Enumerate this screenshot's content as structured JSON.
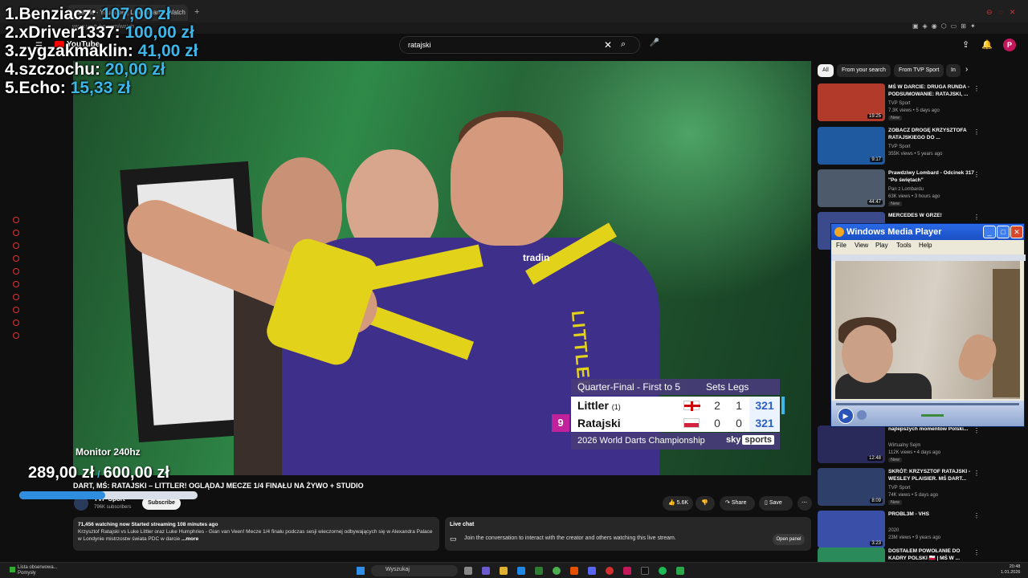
{
  "browser": {
    "tab_title": "ratajski - YouTube | Livestream - Watch",
    "url": "www.youtube.com/watch"
  },
  "youtube": {
    "logo": "YouTube",
    "search_value": "ratajski",
    "avatar_letter": "P"
  },
  "leaderboard": [
    {
      "rank": "1.",
      "name": "Benziacz:",
      "amount": "107,00 zł"
    },
    {
      "rank": "2.",
      "name": "xDriver1337:",
      "amount": "100,00 zł"
    },
    {
      "rank": "3.",
      "name": "zygzakmaklin:",
      "amount": "41,00 zł"
    },
    {
      "rank": "4.",
      "name": "szczochu:",
      "amount": "20,00 zł"
    },
    {
      "rank": "5.",
      "name": "Echo:",
      "amount": "15,33 zł"
    }
  ],
  "donation_goal": {
    "label": "Monitor 240hz",
    "current": "289,00 zł",
    "target": "600,00 zł",
    "progress": 0.48
  },
  "scoreboard": {
    "header_left": "Quarter-Final - First to 5",
    "header_right": "Sets Legs",
    "throwing_score": "9",
    "players": [
      {
        "name": "Littler",
        "seed": "(1)",
        "flag": "england",
        "sets": "2",
        "legs": "1",
        "points": "321"
      },
      {
        "name": "Ratajski",
        "seed": "",
        "flag": "poland",
        "sets": "0",
        "legs": "0",
        "points": "321"
      }
    ],
    "footer": "2026 World Darts Championship",
    "broadcaster": "sky",
    "broadcaster_tag": "sports"
  },
  "video": {
    "shirt_name": "LITTLER",
    "shirt_logo": "tradin",
    "title": "DART, MŚ: RATAJSKI – LITTLER! OGLĄDAJ MECZE 1/4 FINAŁU NA ŻYWO + STUDIO",
    "channel": "TVP Sport",
    "subscribers": "796K subscribers",
    "subscribe_label": "Subscribe",
    "likes": "5.6K",
    "share_label": "Share",
    "save_label": "Save"
  },
  "description": {
    "stats": "71,456 watching now  Started streaming 108 minutes ago",
    "text": "Krzysztof Ratajski vs Luke Littler oraz Luke Humphries - Gian van Veen! Mecze 1/4 finału podczas sesji wieczornej odbywających się w Alexandra Palace w Londynie mistrzostw świata PDC w darcie",
    "more": "...more"
  },
  "live_chat": {
    "title": "Live chat",
    "text": "Join the conversation to interact with the creator and others watching this live stream.",
    "open_label": "Open panel"
  },
  "chips": [
    "All",
    "From your search",
    "From TVP Sport",
    "In"
  ],
  "recommendations": [
    {
      "title": "MŚ W DARCIE: DRUGA RUNDA - PODSUMOWANIE: RATAJSKI, ...",
      "channel": "TVP Sport",
      "meta": "7.3K views • 5 days ago",
      "badge": "New",
      "duration": "19:25",
      "thumb": "#b23a2a"
    },
    {
      "title": "ZOBACZ DROGĘ KRZYSZTOFA RATAJSKIEGO DO ...",
      "channel": "TVP Sport",
      "meta": "355K views • 5 years ago",
      "badge": "",
      "duration": "9:17",
      "thumb": "#1f5aa0"
    },
    {
      "title": "Prawdziwy Lombard - Odcinek 317 \"Po świętach\"",
      "channel": "Pan z Lombardu",
      "meta": "63K views • 3 hours ago",
      "badge": "New",
      "duration": "44:47",
      "thumb": "#4c5a6b"
    },
    {
      "title": "MERCEDES W GRZE!",
      "channel": "",
      "meta": "",
      "badge": "",
      "duration": "",
      "thumb": "#3a4a8a"
    },
    {
      "title": "najlepszych momentów Polski...",
      "channel": "Wirtualny Sejm",
      "meta": "112K views • 4 days ago",
      "badge": "New",
      "duration": "12:48",
      "thumb": "#2a2a5a"
    },
    {
      "title": "SKRÓT: KRZYSZTOF RATAJSKI - WESLEY PLAISIER. MŚ DART...",
      "channel": "TVP Sport",
      "meta": "74K views • 5 days ago",
      "badge": "New",
      "duration": "8:09",
      "thumb": "#2e3f6a"
    },
    {
      "title": "PROBL3M - VHS",
      "channel": "2020",
      "meta": "23M views • 9 years ago",
      "badge": "",
      "duration": "3:23",
      "thumb": "#3a4fa8"
    },
    {
      "title": "DOSTAŁEM POWOŁANIE DO KADRY POLSKI 🇵🇱 | MŚ W ...",
      "channel": "",
      "meta": "",
      "badge": "",
      "duration": "",
      "thumb": "#2a8a5a"
    }
  ],
  "wmp": {
    "title": "Windows Media Player",
    "menu": [
      "File",
      "View",
      "Play",
      "Tools",
      "Help"
    ]
  },
  "taskbar": {
    "weather_title": "Lista obserwowa...",
    "weather_sub": "Pomysły",
    "search": "Wyszukaj",
    "time": "20:48",
    "date": "1.01.2026"
  }
}
